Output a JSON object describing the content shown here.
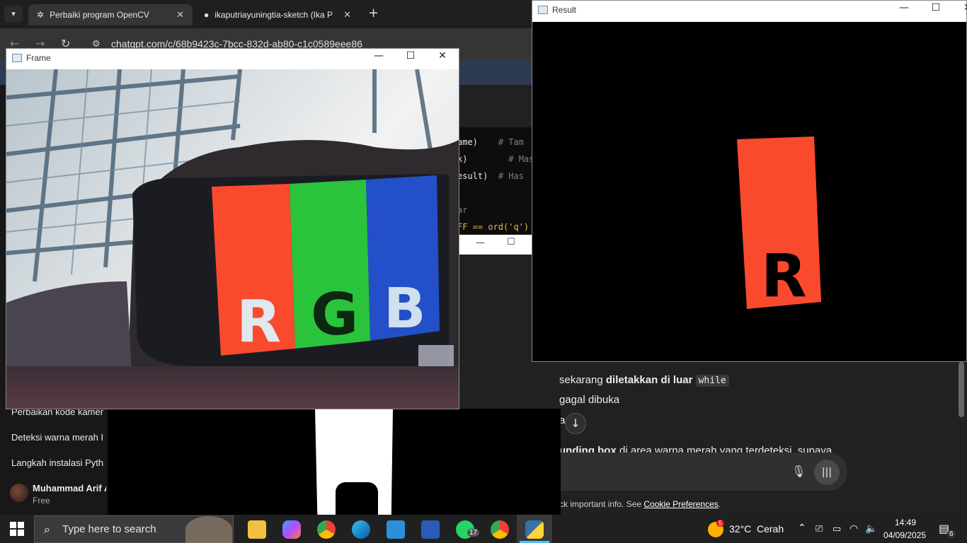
{
  "browser": {
    "tabs": [
      {
        "title": "Perbaiki program OpenCV",
        "active": true
      },
      {
        "title": "ikaputriayuningtia-sketch (Ika P",
        "active": false
      }
    ],
    "new_tab_symbol": "+",
    "url": "chatgpt.com/c/68b9423c-7bcc-832d-ab80-c1c0589eee86"
  },
  "sidebar": {
    "items": [
      {
        "label": "Perbaikan kode kamer"
      },
      {
        "label": "Deteksi warna merah I"
      },
      {
        "label": "Langkah instalasi Pyth"
      }
    ],
    "user": {
      "name": "Muhammad Arif A",
      "plan": "Free"
    }
  },
  "code_lines": [
    {
      "code": "ame)",
      "comment": "# Tam"
    },
    {
      "code": "k)",
      "comment": "# Mas"
    },
    {
      "code": "esult)",
      "comment": "# Has"
    },
    {
      "code": "",
      "comment": "ar"
    },
    {
      "code": "FF == ord('q')",
      "comment": ""
    }
  ],
  "chat": {
    "line1_pre": "sekarang ",
    "line1_bold": "diletakkan di luar",
    "line1_code": "while",
    "line2": "gagal dibuka",
    "line3": "a",
    "line4_bold": "unding box",
    "line4_rest": " di area warna merah yang terdeteksi, supaya",
    "footnote_pre": "ck important info. See ",
    "footnote_link": "Cookie Preferences",
    "footnote_post": "."
  },
  "windows": {
    "frame": {
      "title": "Frame",
      "letters": [
        "R",
        "G",
        "B"
      ]
    },
    "result": {
      "title": "Result",
      "letter": "R"
    }
  },
  "taskbar": {
    "search_placeholder": "Type here to search",
    "whatsapp_badge": "17",
    "weather": {
      "temp": "32°C",
      "condition": "Cerah",
      "badge": "5"
    },
    "time": "14:49",
    "date": "04/09/2025",
    "notifications": "6"
  },
  "colors": {
    "red": "#fa4a2e",
    "green": "#29c43c",
    "blue": "#2350c8",
    "accent": "#0078d4"
  }
}
